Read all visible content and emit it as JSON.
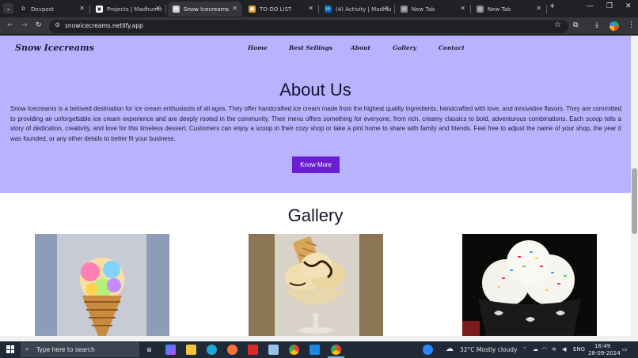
{
  "browser": {
    "tabs": [
      {
        "label": "Devpost",
        "icon": "devpost-icon",
        "color": "#1a1a1a",
        "glyph": "D",
        "active": false
      },
      {
        "label": "Projects | Madhumit",
        "icon": "projects-icon",
        "color": "#ffffff",
        "glyph": "▣",
        "active": false
      },
      {
        "label": "Snow Icecreams",
        "icon": "netlify-icon",
        "color": "#d0d0d0",
        "glyph": "◓",
        "active": true
      },
      {
        "label": "TO-DO LIST",
        "icon": "todo-icon",
        "color": "#e0a030",
        "glyph": "●",
        "active": false
      },
      {
        "label": "(4) Activity | Madhun",
        "icon": "linkedin-icon",
        "color": "#0a66c2",
        "glyph": "in",
        "active": false
      },
      {
        "label": "New Tab",
        "icon": "chrome-icon",
        "color": "#888888",
        "glyph": "◎",
        "active": false
      },
      {
        "label": "New Tab",
        "icon": "chrome-icon",
        "color": "#888888",
        "glyph": "◎",
        "active": false
      }
    ],
    "url": "snowicecreams.netlify.app"
  },
  "site": {
    "brand": "Snow Icecreams",
    "nav": [
      "Home",
      "Best Sellings",
      "About",
      "Gallery",
      "Contact"
    ],
    "about": {
      "title": "About Us",
      "text": "Snow Icecreams is a beloved destination for ice cream enthusiasts of all ages. They offer handcrafted ice cream made from the highest quality ingredients, handcrafted with love, and innovative flavors. They are committed to providing an unforgettable ice cream experience and are deeply rooted in the community. Their menu offers something for everyone, from rich, creamy classics to bold, adventurous combinations. Each scoop tells a story of dedication, creativity, and love for this timeless dessert. Customers can enjoy a scoop in their cozy shop or take a pint home to share with family and friends. Feel free to adjust the name of your shop, the year it was founded, or any other details to better fit your business.",
      "button": "Know More"
    },
    "gallery": {
      "title": "Gallery"
    },
    "colors": {
      "hero": "#b9b2ff",
      "button": "#6a1ed1"
    }
  },
  "taskbar": {
    "search_placeholder": "Type here to search",
    "weather": "32°C  Mostly cloudy",
    "lang": "ENG",
    "time": "16:49",
    "date": "28-09-2024"
  }
}
